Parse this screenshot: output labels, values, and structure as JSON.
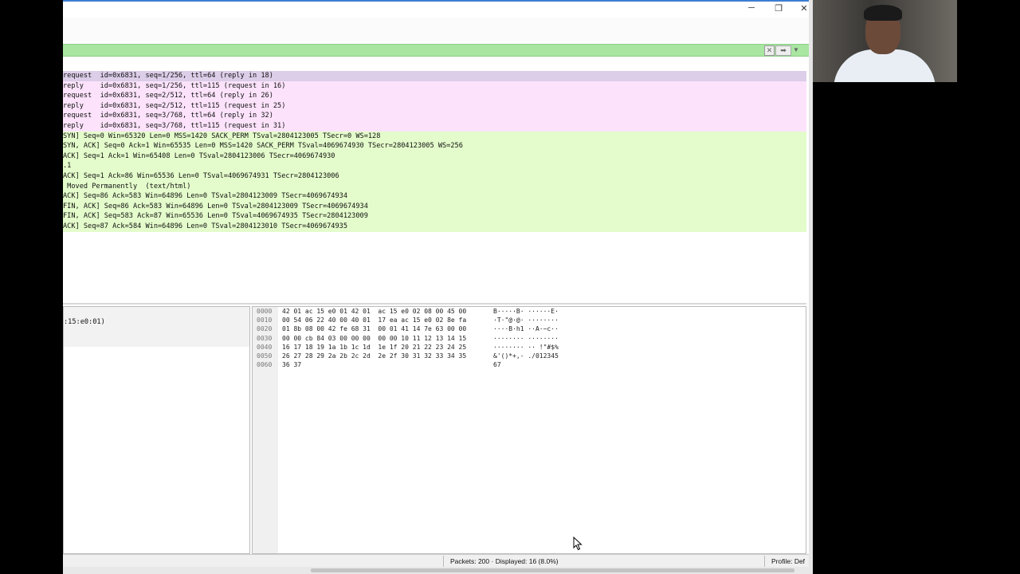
{
  "window": {
    "minimize": "─",
    "restore": "❐",
    "close": "✕"
  },
  "filter_bar": {
    "clear_icon": "clear-filter-icon",
    "apply_icon": "apply-filter-icon",
    "dropdown_icon": "chevron-down-icon"
  },
  "packet_list": {
    "rows": [
      {
        "text": "request  id=0x6831, seq=1/256, ttl=64 (reply in 18)",
        "kind": "selected"
      },
      {
        "text": "reply    id=0x6831, seq=1/256, ttl=115 (request in 16)",
        "kind": "icmp"
      },
      {
        "text": "request  id=0x6831, seq=2/512, ttl=64 (reply in 26)",
        "kind": "icmp"
      },
      {
        "text": "reply    id=0x6831, seq=2/512, ttl=115 (request in 25)",
        "kind": "icmp"
      },
      {
        "text": "request  id=0x6831, seq=3/768, ttl=64 (reply in 32)",
        "kind": "icmp"
      },
      {
        "text": "reply    id=0x6831, seq=3/768, ttl=115 (request in 31)",
        "kind": "icmp"
      },
      {
        "text": "SYN] Seq=0 Win=65320 Len=0 MSS=1420 SACK_PERM TSval=2804123005 TSecr=0 WS=128",
        "kind": "tcp"
      },
      {
        "text": "SYN, ACK] Seq=0 Ack=1 Win=65535 Len=0 MSS=1420 SACK_PERM TSval=4069674930 TSecr=2804123005 WS=256",
        "kind": "tcp"
      },
      {
        "text": "ACK] Seq=1 Ack=1 Win=65408 Len=0 TSval=2804123006 TSecr=4069674930",
        "kind": "tcp"
      },
      {
        "text": ".1",
        "kind": "tcp"
      },
      {
        "text": "ACK] Seq=1 Ack=86 Win=65536 Len=0 TSval=4069674931 TSecr=2804123006",
        "kind": "tcp"
      },
      {
        "text": " Moved Permanently  (text/html)",
        "kind": "tcp"
      },
      {
        "text": "ACK] Seq=86 Ack=583 Win=64896 Len=0 TSval=2804123009 TSecr=4069674934",
        "kind": "tcp"
      },
      {
        "text": "FIN, ACK] Seq=86 Ack=583 Win=64896 Len=0 TSval=2804123009 TSecr=4069674934",
        "kind": "tcp"
      },
      {
        "text": "FIN, ACK] Seq=583 Ack=87 Win=65536 Len=0 TSval=4069674935 TSecr=2804123009",
        "kind": "tcp"
      },
      {
        "text": "ACK] Seq=87 Ack=584 Win=64896 Len=0 TSval=2804123010 TSecr=4069674935",
        "kind": "tcp"
      }
    ]
  },
  "detail_pane": {
    "text": ":15:e0:01)"
  },
  "bytes_pane": {
    "offsets": [
      "0000",
      "0010",
      "0020",
      "0030",
      "0040",
      "0050",
      "0060"
    ],
    "hex": [
      "42 01 ac 15 e0 01 42 01  ac 15 e0 02 08 00 45 00",
      "00 54 06 22 40 00 40 01  17 ea ac 15 e0 02 8e fa",
      "01 8b 08 00 42 fe 68 31  00 01 41 14 7e 63 00 00",
      "00 00 cb 84 03 00 00 00  00 00 10 11 12 13 14 15",
      "16 17 18 19 1a 1b 1c 1d  1e 1f 20 21 22 23 24 25",
      "26 27 28 29 2a 2b 2c 2d  2e 2f 30 31 32 33 34 35",
      "36 37"
    ],
    "ascii": [
      "B·····B· ······E·",
      "·T·\"@·@· ········",
      "····B·h1 ··A·~c··",
      "········ ········",
      "········ ·· !\"#$%",
      "&'()*+,- ./012345",
      "67"
    ]
  },
  "status_bar": {
    "packets": "Packets: 200 · Displayed: 16 (8.0%)",
    "profile": "Profile: Def"
  }
}
